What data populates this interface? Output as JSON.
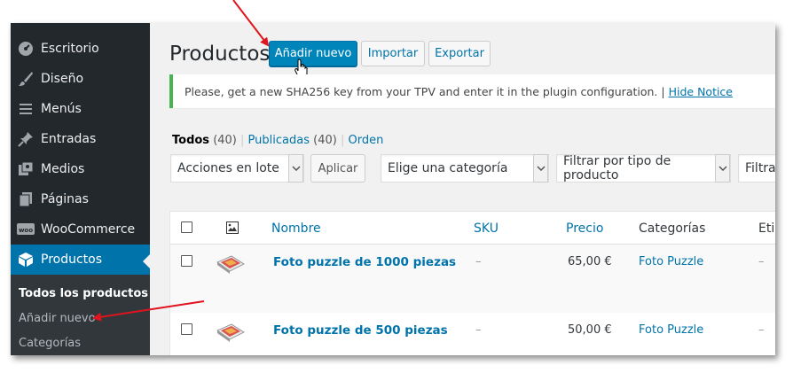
{
  "sidebar": {
    "items": [
      {
        "label": "Escritorio",
        "icon": "dashboard-icon"
      },
      {
        "label": "Diseño",
        "icon": "brush-icon"
      },
      {
        "label": "Menús",
        "icon": "menu-lines-icon"
      },
      {
        "label": "Entradas",
        "icon": "pin-icon"
      },
      {
        "label": "Medios",
        "icon": "media-icon"
      },
      {
        "label": "Páginas",
        "icon": "page-icon"
      },
      {
        "label": "WooCommerce",
        "icon": "woo-icon"
      },
      {
        "label": "Productos",
        "icon": "box-icon"
      }
    ],
    "submenu": [
      {
        "label": "Todos los productos"
      },
      {
        "label": "Añadir nuevo"
      },
      {
        "label": "Categorías"
      }
    ]
  },
  "header": {
    "title": "Productos",
    "add_new": "Añadir nuevo",
    "import": "Importar",
    "export": "Exportar"
  },
  "notice": {
    "text": "Please, get a new SHA256 key from your TPV and enter it in the plugin configuration. |",
    "link": "Hide Notice"
  },
  "filters": {
    "all": "Todos",
    "all_count": "(40)",
    "published": "Publicadas",
    "published_count": "(40)",
    "separator": "|",
    "order": "Orden"
  },
  "toolbar": {
    "bulk_actions": "Acciones en lote",
    "apply": "Aplicar",
    "category": "Elige una categoría",
    "product_type": "Filtrar por tipo de producto",
    "stock": "Filtrar"
  },
  "table": {
    "headers": {
      "name": "Nombre",
      "sku": "SKU",
      "price": "Precio",
      "categories": "Categorías",
      "tags": "Etiq"
    },
    "rows": [
      {
        "name": "Foto puzzle de 1000 piezas",
        "sku": "–",
        "price": "65,00 €",
        "category": "Foto Puzzle",
        "tags": "–"
      },
      {
        "name": "Foto puzzle de 500 piezas",
        "sku": "–",
        "price": "50,00 €",
        "category": "Foto Puzzle",
        "tags": "–"
      }
    ]
  },
  "colors": {
    "sidebar_bg": "#23282d",
    "active_bg": "#0073aa",
    "primary_button": "#0085ba",
    "link": "#0073aa",
    "notice_border": "#46b450",
    "annotation_arrow": "#e0141e"
  }
}
